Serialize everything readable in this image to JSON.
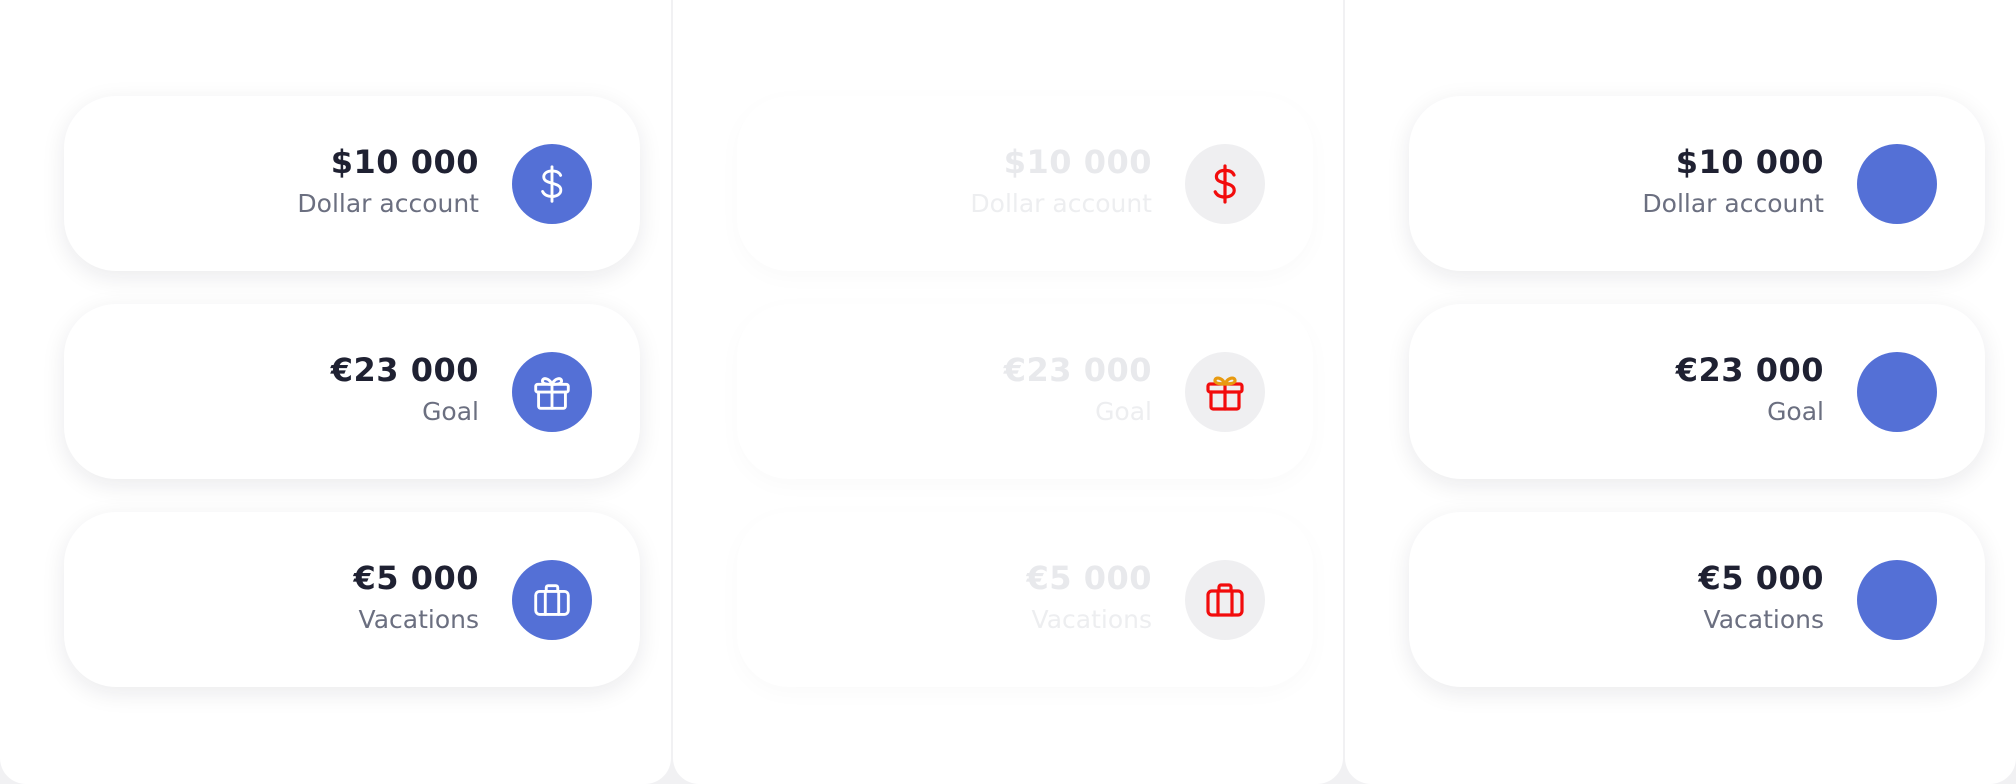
{
  "colors": {
    "accent": "#5470d6",
    "ghost_icon": "#f20c0c",
    "ghost_circle": "#efeff1",
    "amount_text": "#1f2132",
    "label_text": "#6b6f80"
  },
  "panels": [
    {
      "variant": "default",
      "cards": [
        {
          "amount": "$10 000",
          "label": "Dollar account",
          "icon": "dollar-icon"
        },
        {
          "amount": "€23 000",
          "label": "Goal",
          "icon": "gift-icon"
        },
        {
          "amount": "€5 000",
          "label": "Vacations",
          "icon": "briefcase-icon"
        }
      ]
    },
    {
      "variant": "ghost",
      "cards": [
        {
          "amount": "$10 000",
          "label": "Dollar account",
          "icon": "dollar-icon"
        },
        {
          "amount": "€23 000",
          "label": "Goal",
          "icon": "gift-icon"
        },
        {
          "amount": "€5 000",
          "label": "Vacations",
          "icon": "briefcase-icon"
        }
      ]
    },
    {
      "variant": "no-icon",
      "cards": [
        {
          "amount": "$10 000",
          "label": "Dollar account",
          "icon": ""
        },
        {
          "amount": "€23 000",
          "label": "Goal",
          "icon": ""
        },
        {
          "amount": "€5 000",
          "label": "Vacations",
          "icon": ""
        }
      ]
    }
  ]
}
